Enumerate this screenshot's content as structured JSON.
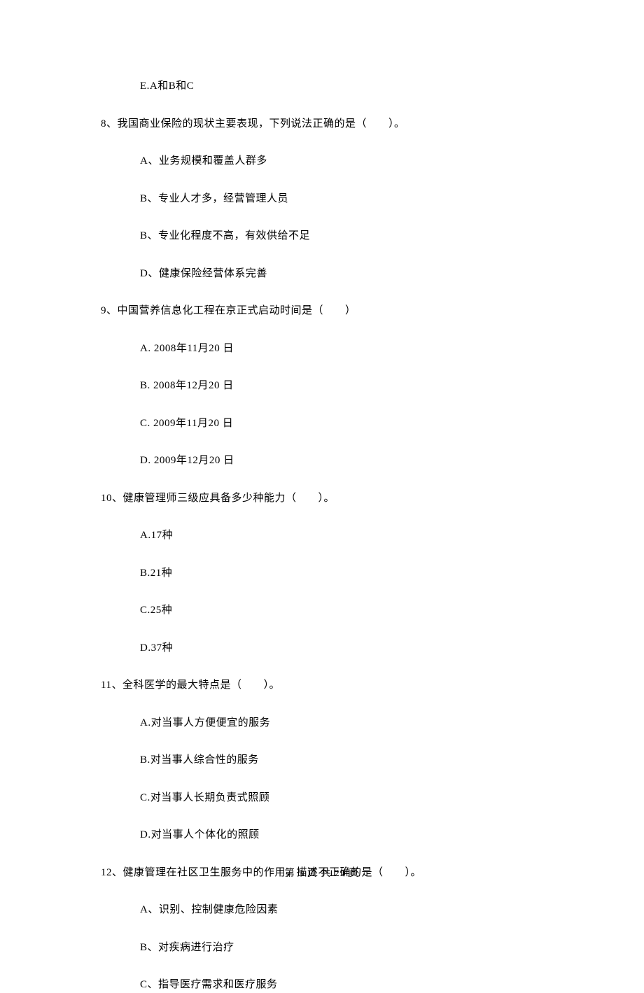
{
  "items": [
    {
      "type": "option",
      "text": "E.A和B和C"
    },
    {
      "type": "question",
      "text": "8、我国商业保险的现状主要表现，下列说法正确的是（　　）。"
    },
    {
      "type": "option",
      "text": "A、业务规模和覆盖人群多"
    },
    {
      "type": "option",
      "text": "B、专业人才多，经营管理人员"
    },
    {
      "type": "option",
      "text": "B、专业化程度不高，有效供给不足"
    },
    {
      "type": "option",
      "text": "D、健康保险经营体系完善"
    },
    {
      "type": "question",
      "text": "9、中国营养信息化工程在京正式启动时间是（　　）"
    },
    {
      "type": "option",
      "text": "A. 2008年11月20 日"
    },
    {
      "type": "option",
      "text": "B. 2008年12月20 日"
    },
    {
      "type": "option",
      "text": "C. 2009年11月20 日"
    },
    {
      "type": "option",
      "text": "D. 2009年12月20 日"
    },
    {
      "type": "question",
      "text": "10、健康管理师三级应具备多少种能力（　　）。"
    },
    {
      "type": "option",
      "text": "A.17种"
    },
    {
      "type": "option",
      "text": "B.21种"
    },
    {
      "type": "option",
      "text": "C.25种"
    },
    {
      "type": "option",
      "text": "D.37种"
    },
    {
      "type": "question",
      "text": "11、全科医学的最大特点是（　　）。"
    },
    {
      "type": "option",
      "text": "A.对当事人方便便宜的服务"
    },
    {
      "type": "option",
      "text": "B.对当事人综合性的服务"
    },
    {
      "type": "option",
      "text": "C.对当事人长期负责式照顾"
    },
    {
      "type": "option",
      "text": "D.对当事人个体化的照顾"
    },
    {
      "type": "question",
      "text": "12、健康管理在社区卫生服务中的作用，描述不正确的是（　　）。"
    },
    {
      "type": "option",
      "text": "A、识别、控制健康危险因素"
    },
    {
      "type": "option",
      "text": "B、对疾病进行治疗"
    },
    {
      "type": "option",
      "text": "C、指导医疗需求和医疗服务"
    }
  ],
  "footer": "第 3 页 共 29 页"
}
